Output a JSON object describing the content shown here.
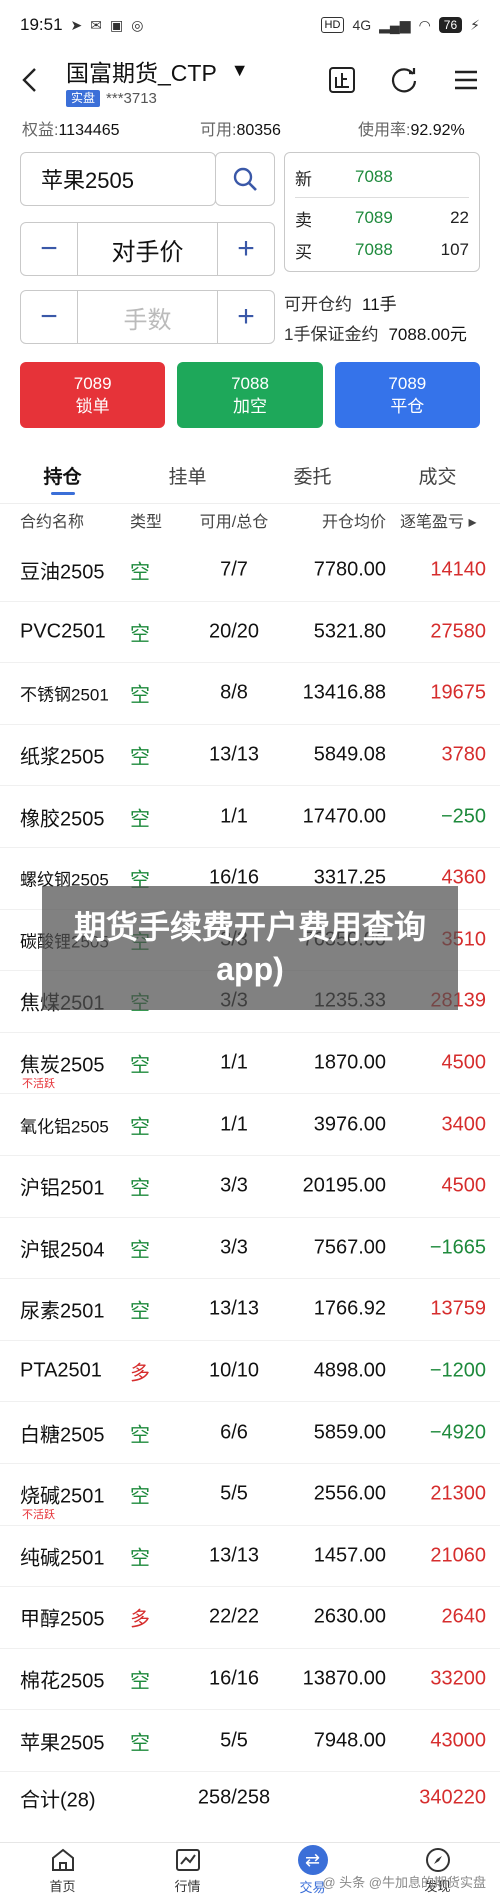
{
  "status_bar": {
    "time": "19:51",
    "network": "4G",
    "battery": "76"
  },
  "header": {
    "title": "国富期货_CTP",
    "tag": "实盘",
    "account": "***3713"
  },
  "account": {
    "equity_label": "权益:",
    "equity_value": "1134465",
    "available_label": "可用:",
    "available_value": "80356",
    "usage_label": "使用率:",
    "usage_value": "92.92%"
  },
  "trade": {
    "contract": "苹果2505",
    "price_mode": "对手价",
    "quantity_placeholder": "手数",
    "minus": "−",
    "plus": "+",
    "quote": {
      "last_label": "新",
      "last_price": "7088",
      "ask_label": "卖",
      "ask_price": "7089",
      "ask_vol": "22",
      "bid_label": "买",
      "bid_price": "7088",
      "bid_vol": "107"
    },
    "can_open_label": "可开仓约",
    "can_open_value": "11手",
    "margin_label": "1手保证金约",
    "margin_value": "7088.00元"
  },
  "orders": {
    "lock_price": "7089",
    "lock_label": "锁单",
    "short_price": "7088",
    "short_label": "加空",
    "close_price": "7089",
    "close_label": "平仓"
  },
  "tabs": [
    "持仓",
    "挂单",
    "委托",
    "成交"
  ],
  "table": {
    "headers": {
      "name": "合约名称",
      "type": "类型",
      "qty": "可用/总仓",
      "price": "开仓均价",
      "pl": "逐笔盈亏 ▸"
    },
    "rows": [
      {
        "name": "豆油2505",
        "type": "空",
        "qty": "7/7",
        "price": "7780.00",
        "pl": "14140",
        "sign": "pos"
      },
      {
        "name": "PVC2501",
        "type": "空",
        "qty": "20/20",
        "price": "5321.80",
        "pl": "27580",
        "sign": "pos"
      },
      {
        "name": "不锈钢2501",
        "type": "空",
        "qty": "8/8",
        "price": "13416.88",
        "pl": "19675",
        "sign": "pos",
        "small": true
      },
      {
        "name": "纸浆2505",
        "type": "空",
        "qty": "13/13",
        "price": "5849.08",
        "pl": "3780",
        "sign": "pos"
      },
      {
        "name": "橡胶2505",
        "type": "空",
        "qty": "1/1",
        "price": "17470.00",
        "pl": "−250",
        "sign": "neg"
      },
      {
        "name": "螺纹钢2505",
        "type": "空",
        "qty": "16/16",
        "price": "3317.25",
        "pl": "4360",
        "sign": "pos",
        "small": true
      },
      {
        "name": "碳酸锂2505",
        "type": "空",
        "qty": "3/3",
        "price": "76350.00",
        "pl": "3510",
        "sign": "pos",
        "small": true
      },
      {
        "name": "焦煤2501",
        "type": "空",
        "qty": "3/3",
        "price": "1235.33",
        "pl": "28139",
        "sign": "pos"
      },
      {
        "name": "焦炭2505",
        "type": "空",
        "qty": "1/1",
        "price": "1870.00",
        "pl": "4500",
        "sign": "pos",
        "note": "不活跃"
      },
      {
        "name": "氧化铝2505",
        "type": "空",
        "qty": "1/1",
        "price": "3976.00",
        "pl": "3400",
        "sign": "pos",
        "small": true
      },
      {
        "name": "沪铝2501",
        "type": "空",
        "qty": "3/3",
        "price": "20195.00",
        "pl": "4500",
        "sign": "pos"
      },
      {
        "name": "沪银2504",
        "type": "空",
        "qty": "3/3",
        "price": "7567.00",
        "pl": "−1665",
        "sign": "neg"
      },
      {
        "name": "尿素2501",
        "type": "空",
        "qty": "13/13",
        "price": "1766.92",
        "pl": "13759",
        "sign": "pos"
      },
      {
        "name": "PTA2501",
        "type": "多",
        "qty": "10/10",
        "price": "4898.00",
        "pl": "−1200",
        "sign": "neg"
      },
      {
        "name": "白糖2505",
        "type": "空",
        "qty": "6/6",
        "price": "5859.00",
        "pl": "−4920",
        "sign": "neg"
      },
      {
        "name": "烧碱2501",
        "type": "空",
        "qty": "5/5",
        "price": "2556.00",
        "pl": "21300",
        "sign": "pos",
        "note": "不活跃"
      },
      {
        "name": "纯碱2501",
        "type": "空",
        "qty": "13/13",
        "price": "1457.00",
        "pl": "21060",
        "sign": "pos"
      },
      {
        "name": "甲醇2505",
        "type": "多",
        "qty": "22/22",
        "price": "2630.00",
        "pl": "2640",
        "sign": "pos"
      },
      {
        "name": "棉花2505",
        "type": "空",
        "qty": "16/16",
        "price": "13870.00",
        "pl": "33200",
        "sign": "pos"
      },
      {
        "name": "苹果2505",
        "type": "空",
        "qty": "5/5",
        "price": "7948.00",
        "pl": "43000",
        "sign": "pos"
      }
    ],
    "total": {
      "name": "合计(28)",
      "qty": "258/258",
      "pl": "340220"
    }
  },
  "overlay": {
    "text": "期货手续费开户费用查询app)"
  },
  "bottom_nav": {
    "home": "首页",
    "market": "行情",
    "trade": "交易",
    "discover": "发现"
  },
  "watermark": "@ 头条 @牛加息的期货实盘"
}
